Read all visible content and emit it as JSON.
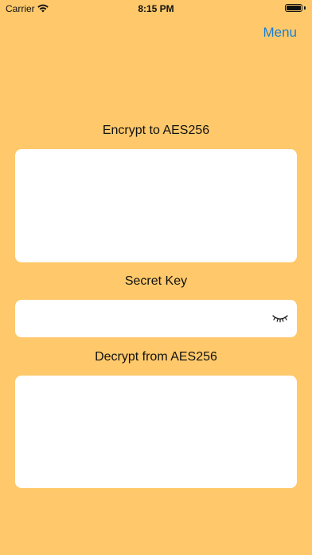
{
  "status_bar": {
    "carrier": "Carrier",
    "time": "8:15 PM",
    "battery_level": 1.0
  },
  "nav": {
    "menu_label": "Menu"
  },
  "encrypt": {
    "label": "Encrypt to AES256",
    "value": ""
  },
  "secret_key": {
    "label": "Secret Key",
    "value": ""
  },
  "decrypt": {
    "label": "Decrypt from AES256",
    "value": ""
  },
  "colors": {
    "background": "#ffc96b",
    "accent": "#1a7fd4",
    "field": "#ffffff"
  },
  "icons": {
    "wifi": "wifi-icon",
    "battery": "battery-icon",
    "visibility": "eye-closed-icon"
  }
}
